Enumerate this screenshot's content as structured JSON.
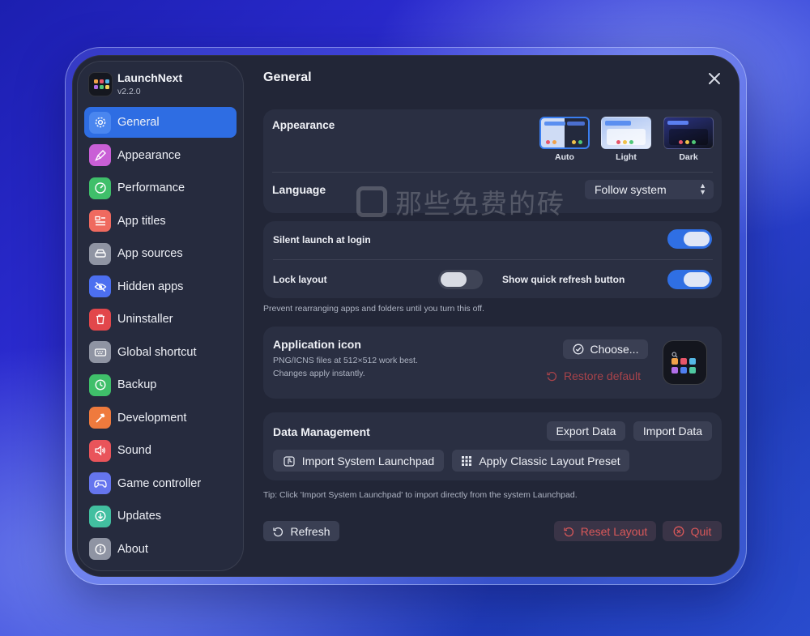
{
  "app": {
    "name": "LaunchNext",
    "version": "v2.2.0"
  },
  "sidebar": {
    "items": [
      {
        "label": "General",
        "icon": "gear-icon",
        "color": "#2e6de3",
        "active": true
      },
      {
        "label": "Appearance",
        "icon": "paintbrush-icon",
        "color": "#c95fd6"
      },
      {
        "label": "Performance",
        "icon": "gauge-icon",
        "color": "#3fbf6a"
      },
      {
        "label": "App titles",
        "icon": "text-list-icon",
        "color": "#ef6a5f"
      },
      {
        "label": "App sources",
        "icon": "drive-icon",
        "color": "#8f94a3"
      },
      {
        "label": "Hidden apps",
        "icon": "eye-slash-icon",
        "color": "#4c6ff0"
      },
      {
        "label": "Uninstaller",
        "icon": "trash-icon",
        "color": "#e2474b"
      },
      {
        "label": "Global shortcut",
        "icon": "keyboard-icon",
        "color": "#8f94a3"
      },
      {
        "label": "Backup",
        "icon": "clock-arrow-icon",
        "color": "#3fbf6a"
      },
      {
        "label": "Development",
        "icon": "hammer-icon",
        "color": "#ef7a3d"
      },
      {
        "label": "Sound",
        "icon": "speaker-icon",
        "color": "#e9545a"
      },
      {
        "label": "Game controller",
        "icon": "gamepad-icon",
        "color": "#6575ee"
      },
      {
        "label": "Updates",
        "icon": "download-arrow-icon",
        "color": "#42bfa0"
      },
      {
        "label": "About",
        "icon": "info-icon",
        "color": "#8f94a3"
      }
    ]
  },
  "main": {
    "title": "General",
    "appearance": {
      "label": "Appearance",
      "options": [
        {
          "name": "Auto",
          "selected": true
        },
        {
          "name": "Light",
          "selected": false
        },
        {
          "name": "Dark",
          "selected": false
        }
      ]
    },
    "language": {
      "label": "Language",
      "value": "Follow system"
    },
    "toggles": {
      "silent_launch": {
        "label": "Silent launch at login",
        "on": true
      },
      "lock_layout": {
        "label": "Lock layout",
        "on": false
      },
      "quick_refresh": {
        "label": "Show quick refresh button",
        "on": true
      },
      "lock_hint": "Prevent rearranging apps and folders until you turn this off."
    },
    "app_icon": {
      "title": "Application icon",
      "hint1": "PNG/ICNS files at 512×512 work best.",
      "hint2": "Changes apply instantly.",
      "choose_label": "Choose...",
      "restore_label": "Restore default"
    },
    "data_management": {
      "title": "Data Management",
      "export_label": "Export Data",
      "import_label": "Import Data",
      "import_system_label": "Import System Launchpad",
      "classic_preset_label": "Apply Classic Layout Preset",
      "tip": "Tip: Click 'Import System Launchpad' to import directly from the system Launchpad."
    },
    "footer": {
      "refresh_label": "Refresh",
      "reset_label": "Reset Layout",
      "quit_label": "Quit"
    }
  },
  "watermark": "那些免费的砖",
  "colors": {
    "accent": "#2e6de3",
    "danger": "#d9585a"
  }
}
